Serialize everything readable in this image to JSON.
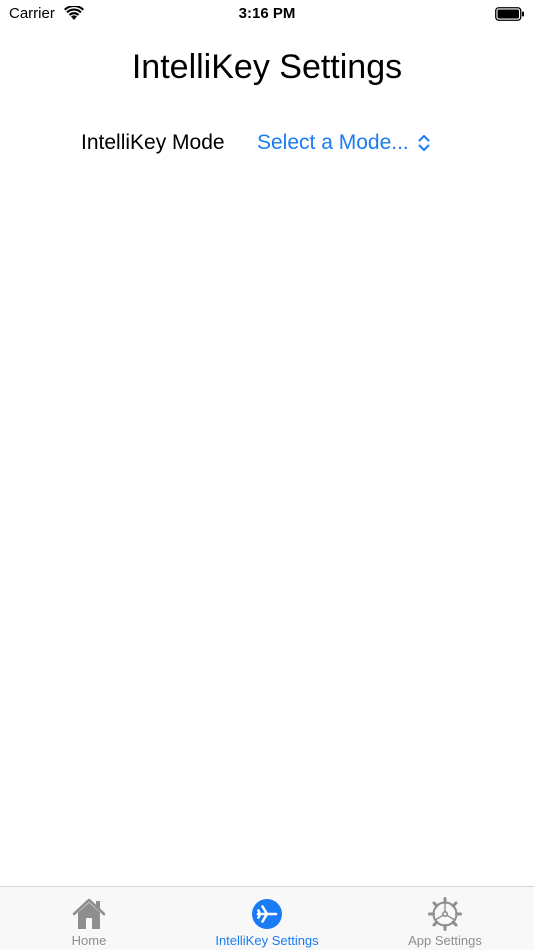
{
  "status_bar": {
    "carrier": "Carrier",
    "time": "3:16 PM"
  },
  "page": {
    "title": "IntelliKey Settings"
  },
  "mode_setting": {
    "label": "IntelliKey Mode",
    "picker_value": "Select a Mode..."
  },
  "tab_bar": {
    "tabs": [
      {
        "label": "Home",
        "icon": "house-icon",
        "active": false
      },
      {
        "label": "IntelliKey Settings",
        "icon": "airplane-circle-icon",
        "active": true
      },
      {
        "label": "App Settings",
        "icon": "gear-icon",
        "active": false
      }
    ]
  },
  "colors": {
    "accent": "#1a7cf5",
    "inactive_tab": "#8e8e8e",
    "tab_bar_bg": "#f8f8f8"
  }
}
